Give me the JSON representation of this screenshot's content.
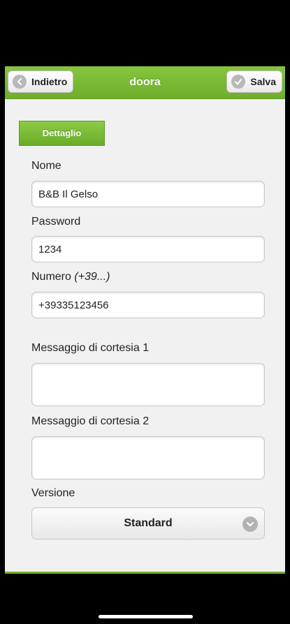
{
  "header": {
    "title": "doora",
    "back_label": "Indietro",
    "save_label": "Salva"
  },
  "tab": {
    "label": "Dettaglio"
  },
  "form": {
    "name_label": "Nome",
    "name_value": "B&B Il Gelso",
    "password_label": "Password",
    "password_value": "1234",
    "number_label": "Numero",
    "number_hint": "(+39...)",
    "number_value": "+39335123456",
    "msg1_label": "Messaggio di cortesia 1",
    "msg1_value": "",
    "msg2_label": "Messaggio di cortesia 2",
    "msg2_value": "",
    "version_label": "Versione",
    "version_value": "Standard"
  },
  "colors": {
    "accent": "#7ab934",
    "background": "#f1f1f1"
  }
}
